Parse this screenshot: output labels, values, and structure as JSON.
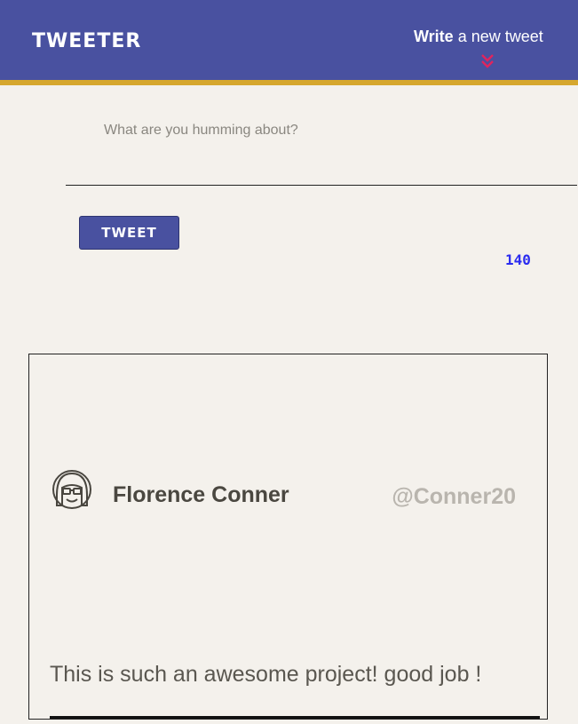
{
  "nav": {
    "brand": "TWEETER",
    "write_bold": "Write",
    "write_rest": " a new tweet",
    "chevron_icon": "double-chevron-down-icon",
    "chevron_color": "#e0245e"
  },
  "composer": {
    "placeholder": "What are you humming about?",
    "value": "",
    "button_label": "TWEET",
    "counter": "140"
  },
  "tweets": [
    {
      "name": "Florence Conner",
      "handle": "@Conner20",
      "avatar_icon": "girl-avatar-icon",
      "text": "This is such an awesome project! good job !"
    }
  ],
  "colors": {
    "header": "#4951a0",
    "header_border": "#d6a72e",
    "background": "#f4f1ec",
    "counter": "#2b2cf0"
  }
}
